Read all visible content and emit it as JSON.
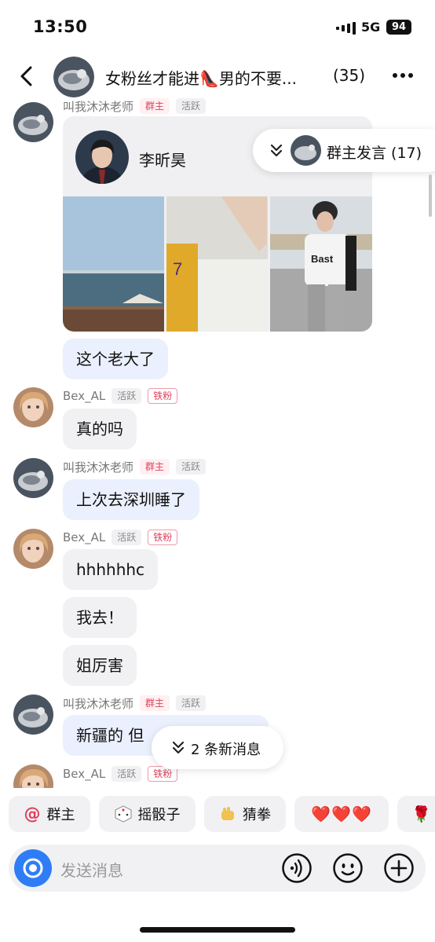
{
  "status": {
    "time": "13:50",
    "network": "5G",
    "battery": "94"
  },
  "header": {
    "title": "女粉丝才能进👠男的不要...",
    "count": "(35)"
  },
  "owner_pill": {
    "label": "群主发言 (17)"
  },
  "card": {
    "name": "李昕昊"
  },
  "messages": [
    {
      "nick": "叫我沐沐老师",
      "badges": [
        "群主",
        "活跃"
      ]
    },
    {
      "text": "这个老大了"
    },
    {
      "nick": "Bex_AL",
      "badges": [
        "活跃",
        "铁粉"
      ],
      "text": "真的吗"
    },
    {
      "nick": "叫我沐沐老师",
      "badges": [
        "群主",
        "活跃"
      ],
      "text": "上次去深圳睡了"
    },
    {
      "nick": "Bex_AL",
      "badges": [
        "活跃",
        "铁粉"
      ],
      "text": "hhhhhhc"
    },
    {
      "text": "我去！"
    },
    {
      "text": "姐厉害"
    },
    {
      "nick": "叫我沐沐老师",
      "badges": [
        "群主",
        "活跃"
      ],
      "text": "新疆的 但"
    },
    {
      "nick": "Bex_AL",
      "badges": [
        "活跃",
        "铁粉"
      ]
    }
  ],
  "new_messages": {
    "label": "2 条新消息"
  },
  "quick_actions": [
    {
      "label": "群主",
      "icon": "at-icon"
    },
    {
      "label": "摇骰子",
      "icon": "dice-icon"
    },
    {
      "label": "猜拳",
      "icon": "fist-icon"
    },
    {
      "label": "❤️❤️❤️",
      "icon": ""
    },
    {
      "label": "🌹",
      "icon": ""
    }
  ],
  "input": {
    "placeholder": "发送消息"
  },
  "colors": {
    "owner_badge": "#e0405a",
    "bubble_blue": "#eaf0fd",
    "bubble_gray": "#f1f1f3",
    "camera": "#2f7df6"
  }
}
